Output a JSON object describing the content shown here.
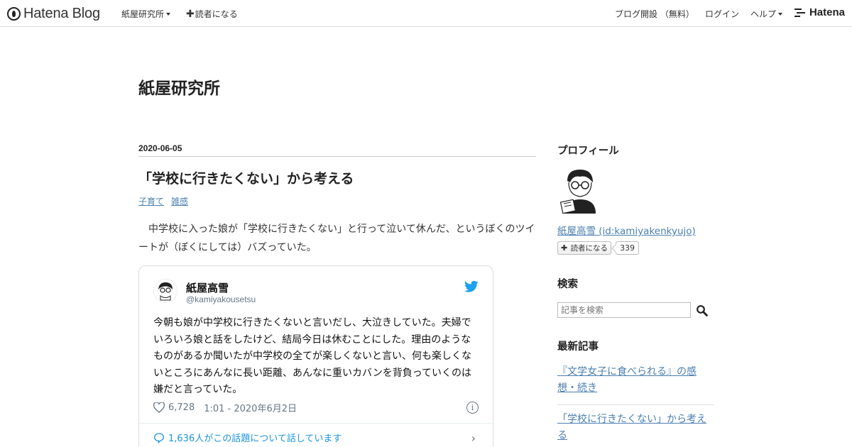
{
  "topbar": {
    "logo_text": "Hatena Blog",
    "blog_menu_label": "紙屋研究所",
    "subscribe_label": "読者になる",
    "open_blog_label": "ブログ開設 （無料）",
    "login_label": "ログイン",
    "help_label": "ヘルプ",
    "brand_label": "Hatena"
  },
  "blog": {
    "title": "紙屋研究所"
  },
  "post": {
    "date": "2020-06-05",
    "title": "「学校に行きたくない」から考える",
    "categories": [
      "子育て",
      "雑感"
    ],
    "body": "　中学校に入った娘が「学校に行きたくない」と行って泣いて休んだ、というぼくのツイートが（ぼくにしては）バズっていた。"
  },
  "tweet": {
    "name": "紙屋高雪",
    "handle": "@kamiyakousetsu",
    "text": "今朝も娘が中学校に行きたくないと言いだし、大泣きしていた。夫婦でいろいろ娘と話をしたけど、結局今日は休むことにした。理由のようなものがあるか聞いたが中学校の全てが楽しくないと言い、何も楽しくないところにあんなに長い距離、あんなに重いカバンを背負っていくのは嫌だと言っていた。",
    "likes": "6,728",
    "timestamp": "1:01 - 2020年6月2日",
    "conversation": "1,636人がこの話題について話しています",
    "accent_color": "#1da1f2"
  },
  "sidebar": {
    "profile_heading": "プロフィール",
    "profile_name": "紙屋高雪 (id:kamiyakenkyujo)",
    "subscribe_label": "読者になる",
    "subscriber_count": "339",
    "search_heading": "検索",
    "search_placeholder": "記事を検索",
    "recent_heading": "最新記事",
    "recent_posts": [
      "『文学女子に食べられる』の感想・続き",
      "「学校に行きたくない」から考える"
    ]
  },
  "colors": {
    "link": "#4a7fb0",
    "text": "#333333"
  }
}
